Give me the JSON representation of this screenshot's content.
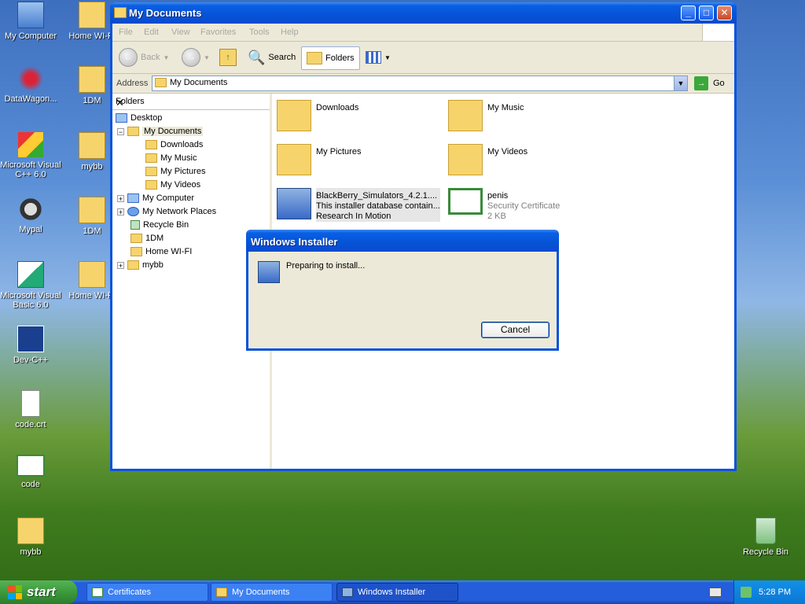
{
  "desktop": {
    "icons": [
      {
        "label": "My Computer"
      },
      {
        "label": "Home WI-FI"
      },
      {
        "label": "DataWagon..."
      },
      {
        "label": "1DM"
      },
      {
        "label": "Microsoft Visual C++ 6.0"
      },
      {
        "label": "mybb"
      },
      {
        "label": "Mypal"
      },
      {
        "label": "1DM"
      },
      {
        "label": "Microsoft Visual Basic 6.0"
      },
      {
        "label": "Home WI-FI"
      },
      {
        "label": "Dev-C++"
      },
      {
        "label": "code.crt"
      },
      {
        "label": "code"
      },
      {
        "label": "mybb"
      },
      {
        "label": "Recycle Bin"
      }
    ]
  },
  "explorer": {
    "title": "My Documents",
    "menu": [
      "File",
      "Edit",
      "View",
      "Favorites",
      "Tools",
      "Help"
    ],
    "toolbar": {
      "back": "Back",
      "search": "Search",
      "folders": "Folders"
    },
    "address": {
      "label": "Address",
      "value": "My Documents",
      "go": "Go"
    },
    "folders_pane": {
      "header": "Folders",
      "tree": [
        "Desktop",
        "My Documents",
        "Downloads",
        "My Music",
        "My Pictures",
        "My Videos",
        "My Computer",
        "My Network Places",
        "Recycle Bin",
        "1DM",
        "Home WI-FI",
        "mybb"
      ]
    },
    "items": [
      {
        "name": "Downloads"
      },
      {
        "name": "My Music"
      },
      {
        "name": "My Pictures"
      },
      {
        "name": "My Videos"
      },
      {
        "name": "BlackBerry_Simulators_4.2.1....",
        "line2": "This installer database contain...",
        "line3": "Research In Motion"
      },
      {
        "name": "penis",
        "line2": "Security Certificate",
        "line3": "2 KB"
      }
    ]
  },
  "installer": {
    "title": "Windows Installer",
    "message": "Preparing to install...",
    "cancel": "Cancel"
  },
  "taskbar": {
    "start": "start",
    "tasks": [
      "Certificates",
      "My Documents",
      "Windows Installer"
    ],
    "clock": "5:28 PM"
  },
  "colors": {
    "titlebar": "#0a53dc",
    "taskbar": "#245edb",
    "start": "#3c9a3c",
    "dialog_face": "#ece9d8"
  }
}
